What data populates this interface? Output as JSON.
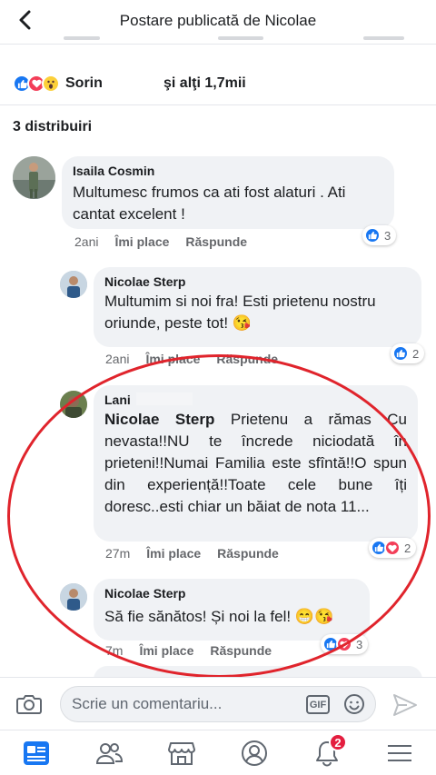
{
  "header": {
    "title": "Postare publicată de Nicolae"
  },
  "reactions": {
    "name": "Sorin",
    "others": "şi alţi 1,7mii"
  },
  "shares": "3 distribuiri",
  "comments": [
    {
      "author": "Isaila Cosmin",
      "text": "Multumesc frumos ca ati fost alaturi . Ati cantat excelent !",
      "time": "2ani",
      "like": "Îmi place",
      "reply": "Răspunde",
      "reaction_count": "3"
    },
    {
      "author": "Nicolae Sterp",
      "text": "Multumim si noi fra! Esti prietenu nostru oriunde, peste tot! 😘",
      "time": "2ani",
      "like": "Îmi place",
      "reply": "Răspunde",
      "reaction_count": "2"
    },
    {
      "author": "Lani",
      "mention": "Nicolae Sterp",
      "text": " Prietenu a rămas Cu nevasta!!NU te încrede niciodată în prieteni!!Numai Familia este sfîntă!!O spun din experiență!!Toate cele bune îți doresc..esti chiar un băiat de nota 11...",
      "time": "27m",
      "like": "Îmi place",
      "reply": "Răspunde",
      "reaction_count": "2"
    },
    {
      "author": "Nicolae Sterp",
      "text": "Să fie sănătos! Și noi la fel! 😁😘",
      "time": "7m",
      "like": "Îmi place",
      "reply": "Răspunde",
      "reaction_count": "3"
    }
  ],
  "composer": {
    "placeholder": "Scrie un comentariu...",
    "gif_label": "GIF"
  },
  "tabbar": {
    "notifications_badge": "2"
  },
  "colors": {
    "accent": "#1877f2",
    "love": "#f33e58",
    "annotation": "#e0242c"
  }
}
